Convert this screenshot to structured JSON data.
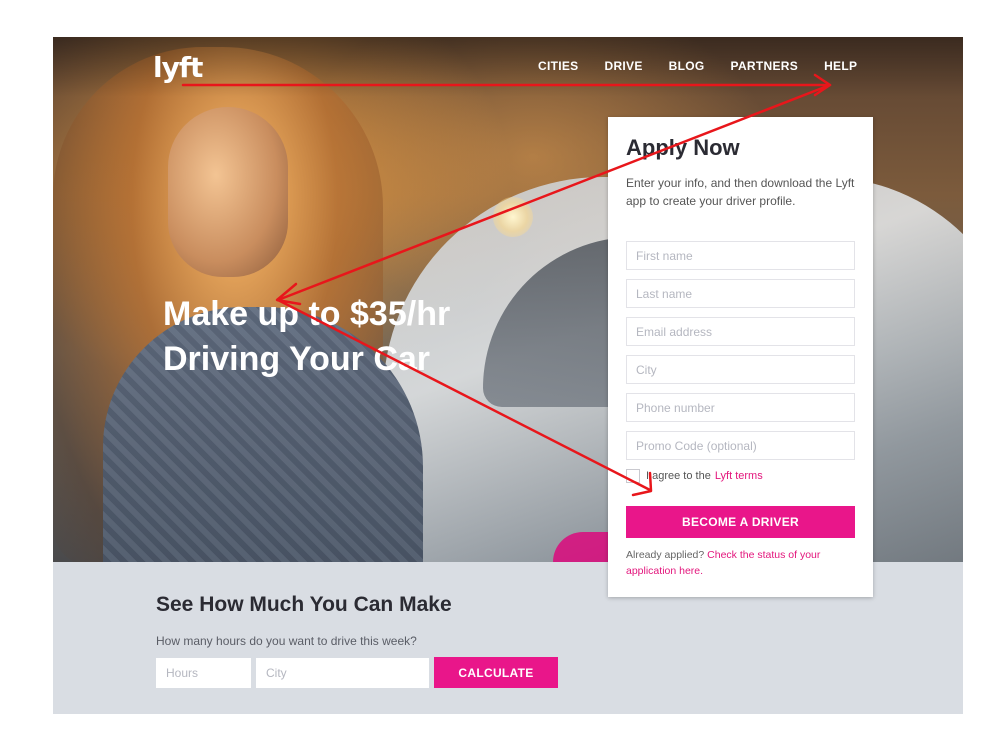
{
  "brand": {
    "logo_text": "lyft"
  },
  "nav": {
    "items": [
      {
        "label": "CITIES"
      },
      {
        "label": "DRIVE"
      },
      {
        "label": "BLOG"
      },
      {
        "label": "PARTNERS"
      },
      {
        "label": "HELP"
      }
    ]
  },
  "hero": {
    "headline_line1": "Make up to $35/hr",
    "headline_line2": "Driving Your Car"
  },
  "apply": {
    "title": "Apply Now",
    "intro": "Enter your info, and then download the Lyft app to create your driver profile.",
    "fields": {
      "first_name": "First name",
      "last_name": "Last name",
      "email": "Email address",
      "city": "City",
      "phone": "Phone number",
      "promo": "Promo Code (optional)"
    },
    "agree_text": "I agree to the",
    "agree_link": "Lyft terms",
    "submit_label": "BECOME A DRIVER",
    "applied_text": "Already applied?",
    "applied_link": "Check the status of your application here."
  },
  "calculator": {
    "title": "See How Much You Can Make",
    "subtitle": "How many hours do you want to drive this week?",
    "hours_placeholder": "Hours",
    "city_placeholder": "City",
    "button_label": "CALCULATE"
  },
  "colors": {
    "accent": "#e9168a",
    "annotation_arrow": "#e8161b"
  },
  "annotations": {
    "arrow_count": 4
  }
}
